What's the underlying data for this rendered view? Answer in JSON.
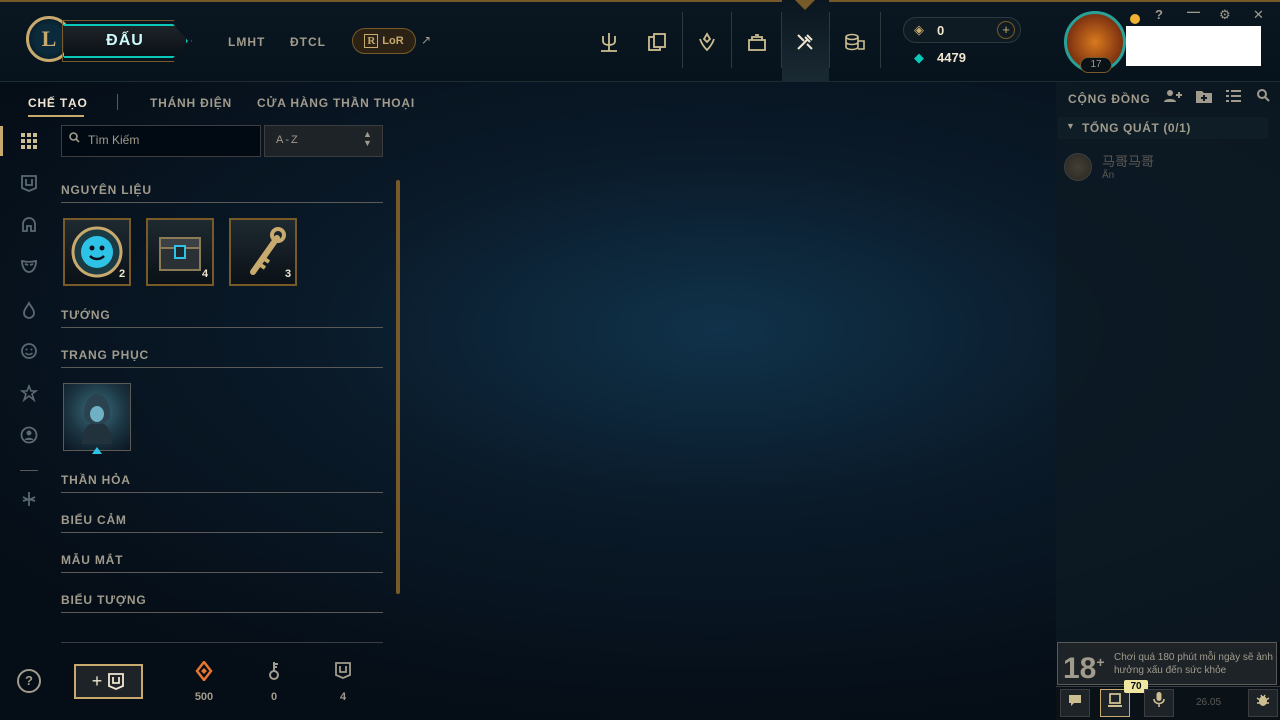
{
  "topbar": {
    "logo": "L",
    "play_label": "ĐẤU",
    "game_links": [
      "LMHT",
      "ĐTCL"
    ],
    "lor_label": "LoR",
    "lor_external_glyph": "↗",
    "nav_icons": [
      "trident-icon",
      "collection-icon",
      "ranked-icon",
      "loot-icon",
      "crafting-icon",
      "store-coins-icon"
    ],
    "rp_value": "0",
    "be_value": "4479",
    "level": "17",
    "window_controls": [
      "?",
      "—",
      "⚙",
      "✕"
    ]
  },
  "subtabs": [
    "CHẾ TẠO",
    "THÁNH ĐIỆN",
    "CỬA HÀNG THẦN THOẠI"
  ],
  "search": {
    "placeholder": "Tìm Kiếm"
  },
  "sort": {
    "value": "A-Z"
  },
  "sections": {
    "materials": "NGUYÊN LIỆU",
    "champions": "TƯỚNG",
    "skins": "TRANG PHỤC",
    "wards": "THẦN HỎA",
    "emotes": "BIỂU CẢM",
    "eyes": "MẪU MẮT",
    "icons": "BIỂU TƯỢNG"
  },
  "materials": [
    {
      "icon": "emote-token-icon",
      "count": "2"
    },
    {
      "icon": "chest-icon",
      "count": "4"
    },
    {
      "icon": "key-icon",
      "count": "3"
    }
  ],
  "footer": {
    "help": "?",
    "add_chest": "+",
    "orange_essence": "500",
    "keys": "0",
    "chests": "4"
  },
  "social": {
    "title": "CỘNG ĐỒNG",
    "group": "TỔNG QUÁT (0/1)",
    "friend_name": "马哥马哥",
    "friend_status": "Ẩn"
  },
  "age_notice": {
    "rating": "18",
    "text": "Chơi quá 180 phút mỗi ngày sẽ ảnh hưởng xấu đến sức khỏe"
  },
  "bottom": {
    "badge": "70",
    "version": "26.05"
  }
}
